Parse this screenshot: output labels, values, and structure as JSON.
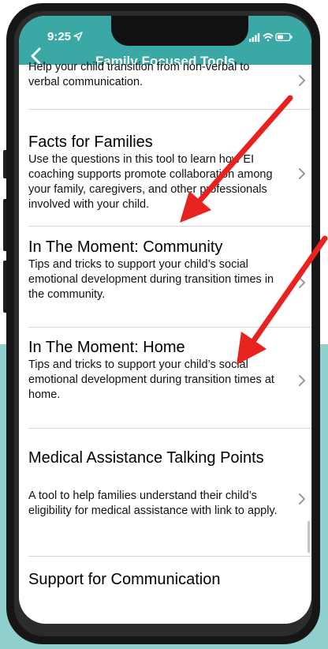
{
  "status_bar": {
    "time": "9:25"
  },
  "nav": {
    "title": "Family Focused Tools"
  },
  "items": [
    {
      "title": "",
      "desc": "Help your child transition from non-verbal to verbal communication."
    },
    {
      "title": "Facts for Families",
      "desc": "Use the questions in this tool to learn how EI coaching supports promote collaboration among your family, caregivers, and other professionals involved with your child."
    },
    {
      "title": "In The Moment: Community",
      "desc": "Tips and tricks to support your child’s social emotional development during transition times in the community."
    },
    {
      "title": "In The Moment: Home",
      "desc": "Tips and tricks to support your child’s social emotional development during transition times at home."
    },
    {
      "title": "Medical Assistance Talking Points",
      "desc": "A tool to help families understand their child’s eligibility for medical assistance with link to apply."
    },
    {
      "title": "Support for Communication",
      "desc": ""
    }
  ],
  "colors": {
    "nav": "#3aa8a4",
    "arrow": "#e8231f",
    "backdrop": "#8fd0ce"
  }
}
